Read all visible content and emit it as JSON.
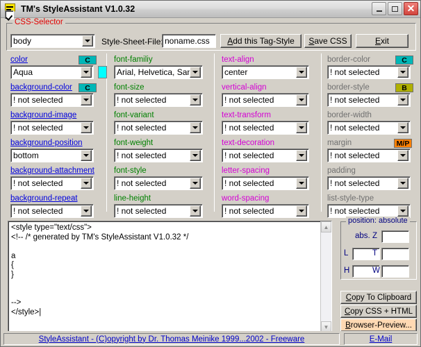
{
  "window": {
    "title": "TM's StyleAssistant V1.0.32",
    "icon": "style-document-icon",
    "minimize_label": "",
    "maximize_label": "",
    "close_label": "✕"
  },
  "selector_group": {
    "legend": "CSS-Selector",
    "selector_value": "body",
    "stylesheet_label": "Style-Sheet-File:",
    "stylesheet_value": "noname.css",
    "buttons": {
      "add_tag_style": {
        "pre": "A",
        "post": "dd this Tag-Style"
      },
      "save_css": {
        "pre": "S",
        "post": "ave CSS"
      },
      "exit": {
        "pre": "E",
        "mid": "xi",
        "post": "t"
      }
    }
  },
  "columns": [
    {
      "name": "color-column",
      "label_color": "#0000dd",
      "props": [
        {
          "label": "color",
          "value": "Aqua",
          "badge": "C",
          "badge_type": "c",
          "swatch": "#00ffff"
        },
        {
          "label": "background-color",
          "value": "! not selected",
          "badge": "C",
          "badge_type": "c"
        },
        {
          "label": "background-image",
          "value": "! not selected"
        },
        {
          "label": "background-position",
          "value": "bottom"
        },
        {
          "label": "background-attachment",
          "value": "! not selected"
        },
        {
          "label": "background-repeat",
          "value": "! not selected"
        }
      ]
    },
    {
      "name": "font-column",
      "label_color": "#008000",
      "props": [
        {
          "label": "font-familiy",
          "value": "Arial, Helvetica, San"
        },
        {
          "label": "font-size",
          "value": "! not selected"
        },
        {
          "label": "font-variant",
          "value": "! not selected"
        },
        {
          "label": "font-weight",
          "value": "! not selected"
        },
        {
          "label": "font-style",
          "value": "! not selected"
        },
        {
          "label": "line-height",
          "value": "! not selected"
        }
      ]
    },
    {
      "name": "text-column",
      "label_color": "#d400d4",
      "props": [
        {
          "label": "text-align",
          "value": "center"
        },
        {
          "label": "vertical-align",
          "value": "! not selected"
        },
        {
          "label": "text-transform",
          "value": "! not selected"
        },
        {
          "label": "text-decoration",
          "value": "! not selected"
        },
        {
          "label": "letter-spacing",
          "value": "! not selected"
        },
        {
          "label": "word-spacing",
          "value": "! not selected"
        }
      ]
    },
    {
      "name": "box-column",
      "label_color": "#707070",
      "props": [
        {
          "label": "border-color",
          "value": "! not selected",
          "badge": "C",
          "badge_type": "c"
        },
        {
          "label": "border-style",
          "value": "! not selected",
          "badge": "B",
          "badge_type": "b"
        },
        {
          "label": "border-width",
          "value": "! not selected"
        },
        {
          "label": "margin",
          "value": "! not selected",
          "badge": "M/P",
          "badge_type": "mp"
        },
        {
          "label": "padding",
          "value": "! not selected"
        },
        {
          "label": "list-style-type",
          "value": "! not selected"
        }
      ]
    }
  ],
  "code": {
    "content": "<style type=\"text/css\">\n<!-- /* generated by TM's StyleAssistant V1.0.32 */\n\na\n{\n}\n\n\n-->\n</style>|",
    "scroll_up": "▲",
    "scroll_down": "▼"
  },
  "position_group": {
    "legend": "position: absolute",
    "checkbox_label": "abs.",
    "checked": true,
    "fields": [
      {
        "label": "Z",
        "value": ""
      },
      {
        "label": "L",
        "value": ""
      },
      {
        "label": "T",
        "value": ""
      },
      {
        "label": "H",
        "value": ""
      },
      {
        "label": "W",
        "value": ""
      }
    ]
  },
  "right_buttons": [
    {
      "name": "copy-to-clipboard",
      "pre": "C",
      "post": "opy To Clipboard",
      "highlight": false
    },
    {
      "name": "copy-css-html",
      "pre": "C",
      "mid": "o",
      "post": "py CSS + HTML",
      "highlight": false
    },
    {
      "name": "browser-preview",
      "pre": "B",
      "post": "rowser-Preview...",
      "highlight": true
    }
  ],
  "statusbar": {
    "left_text": "StyleAssistant - (C)opyright by Dr. Thomas Meinike 1999...2002 - Freeware",
    "right_text": "E-Mail"
  }
}
